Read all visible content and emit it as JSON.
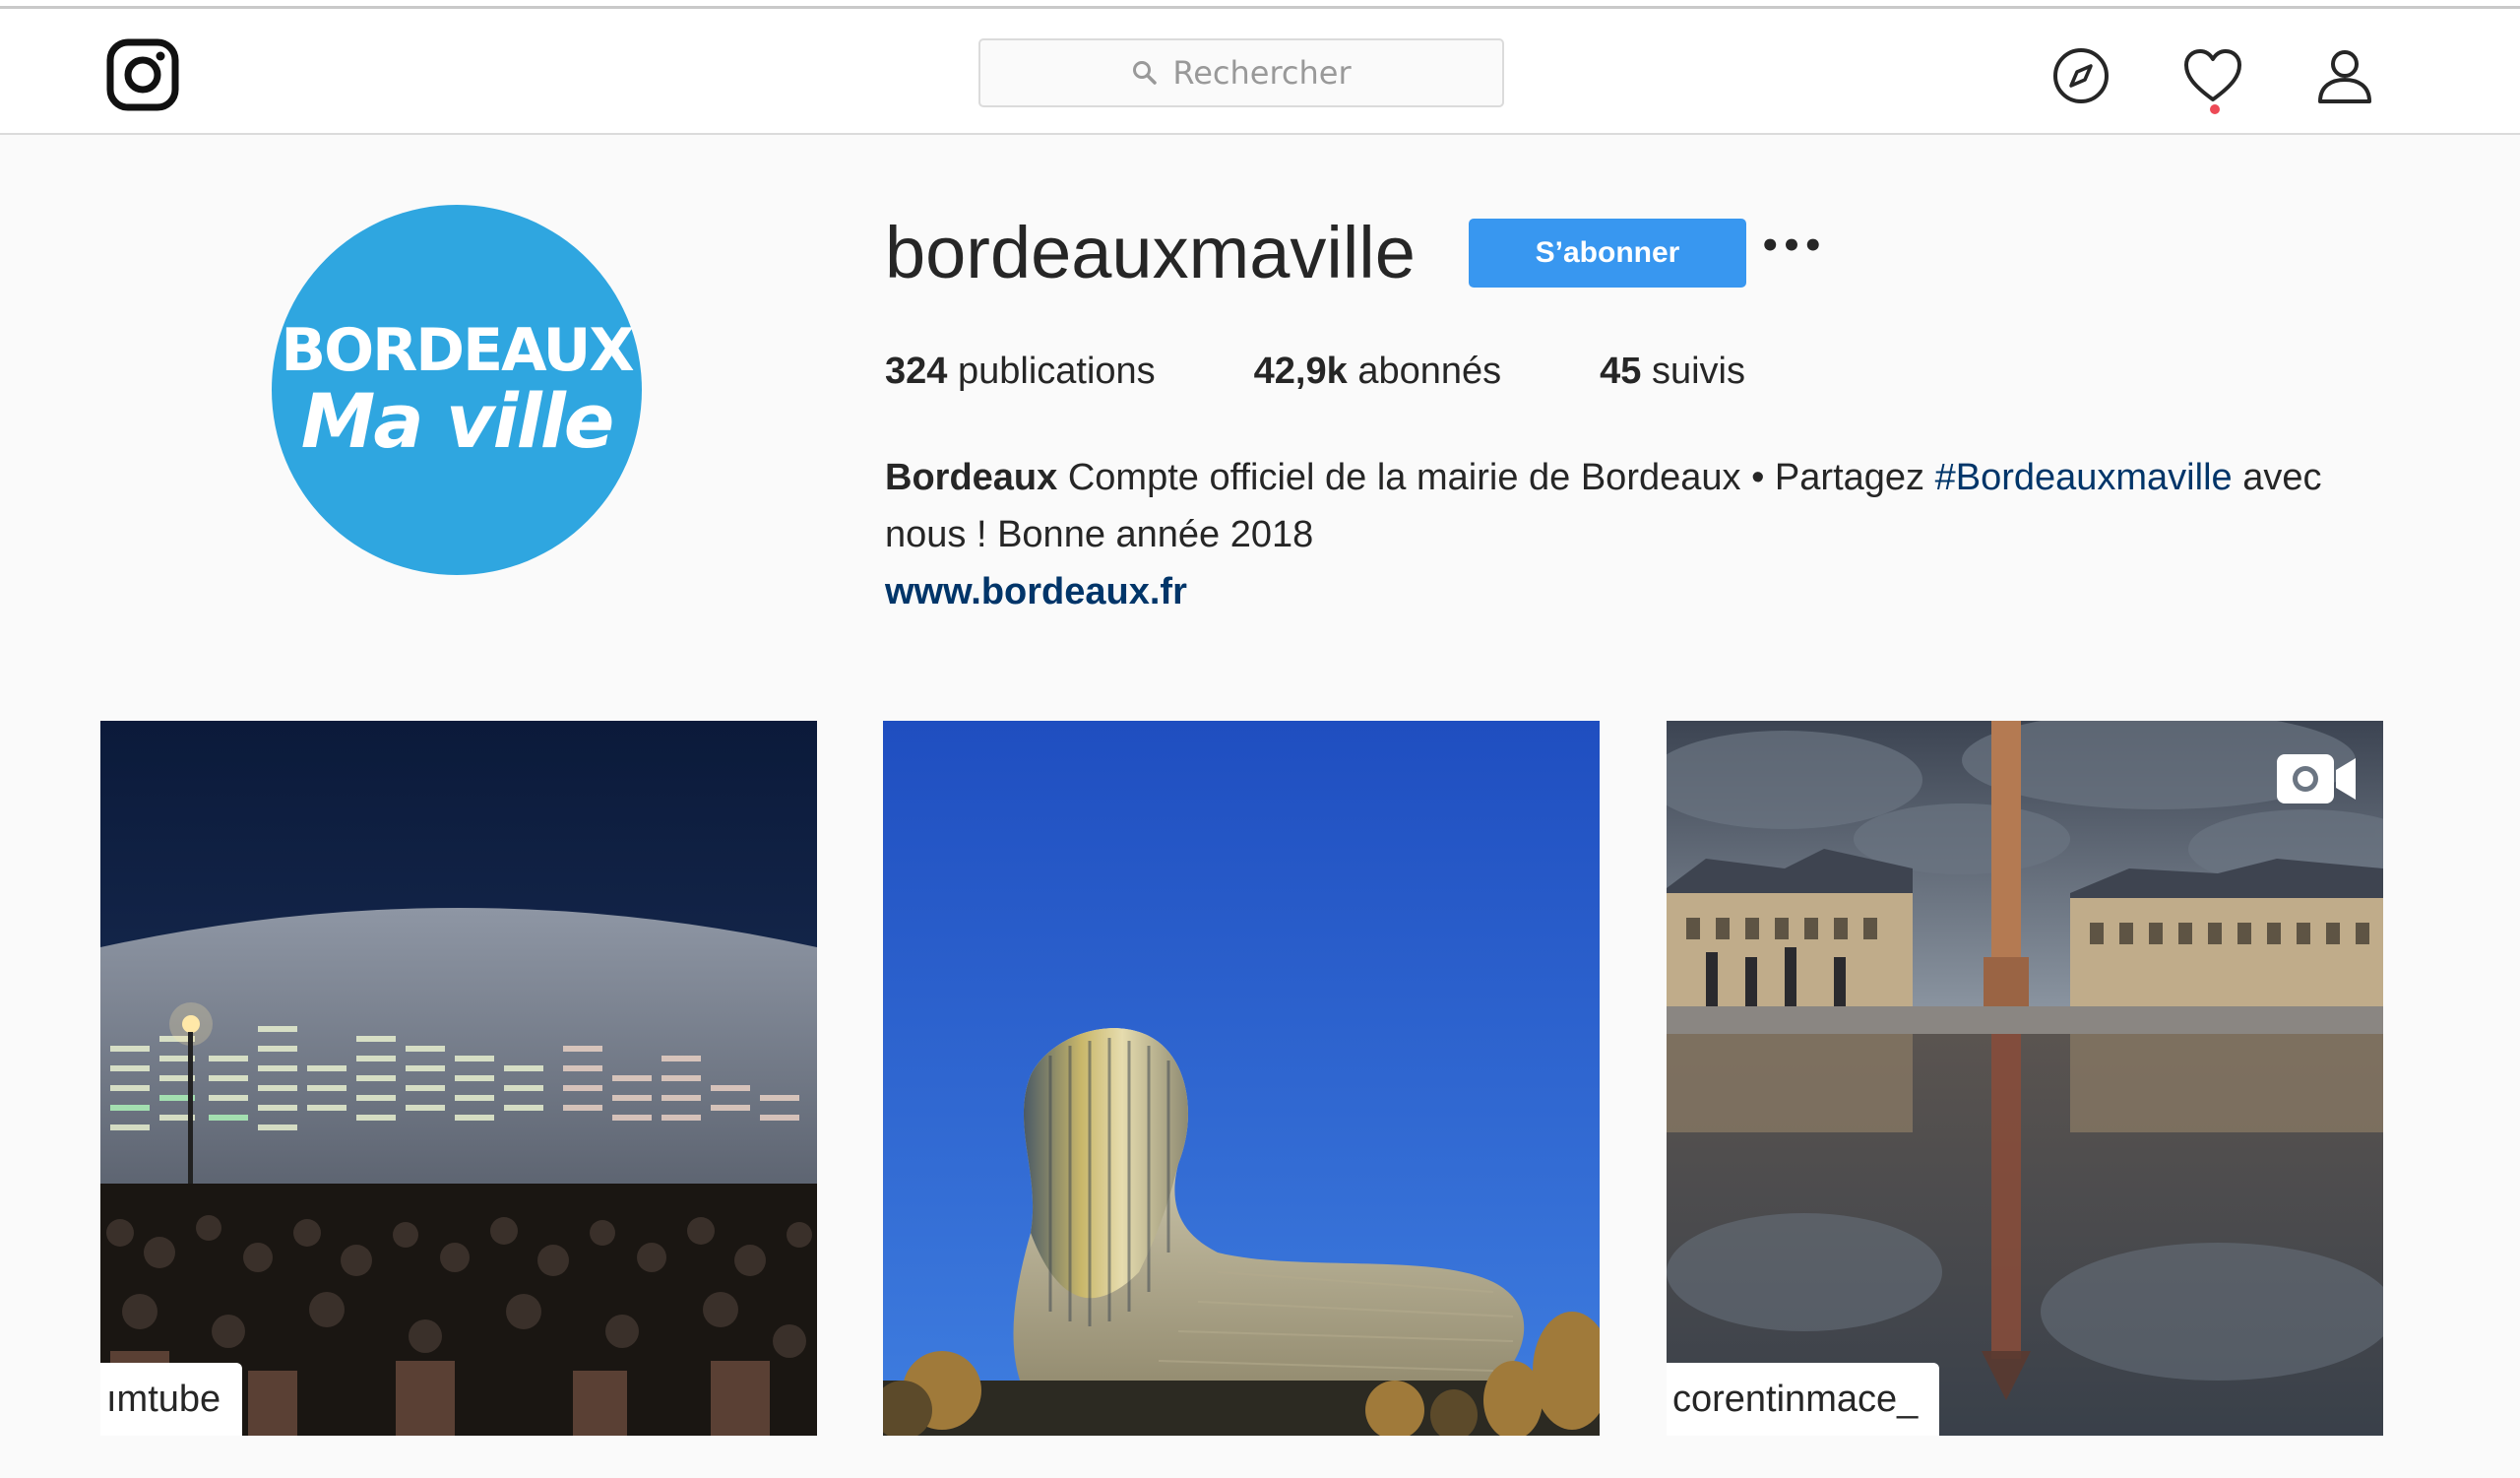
{
  "header": {
    "logo_icon": "instagram-camera-icon",
    "search": {
      "placeholder": "Rechercher",
      "icon": "search-icon"
    },
    "nav_icons": [
      "compass-icon",
      "heart-icon",
      "user-icon"
    ],
    "notification_dot": true
  },
  "profile": {
    "avatar": {
      "line1": "BORDEAUX",
      "line2": "Ma ville",
      "background": "#2fa6e0"
    },
    "username": "bordeauxmaville",
    "follow_label": "S’abonner",
    "more_label": "•••",
    "stats": [
      {
        "value": "324",
        "label": "publications"
      },
      {
        "value": "42,9k",
        "label": "abonnés"
      },
      {
        "value": "45",
        "label": "suivis"
      }
    ],
    "bio": {
      "name": "Bordeaux",
      "text": "Compte officiel de la mairie de Bordeaux • Partagez",
      "hashtag": "#Bordeauxmaville",
      "text2": "avec nous ! Bonne année 2018",
      "link": "www.bordeaux.fr"
    }
  },
  "posts": [
    {
      "credit": "ımtube",
      "video": false
    },
    {
      "credit": "",
      "video": false
    },
    {
      "credit": "corentinmace_",
      "video": true
    }
  ],
  "colors": {
    "accent": "#3897f0",
    "link": "#003569",
    "notification": "#ed4956"
  }
}
